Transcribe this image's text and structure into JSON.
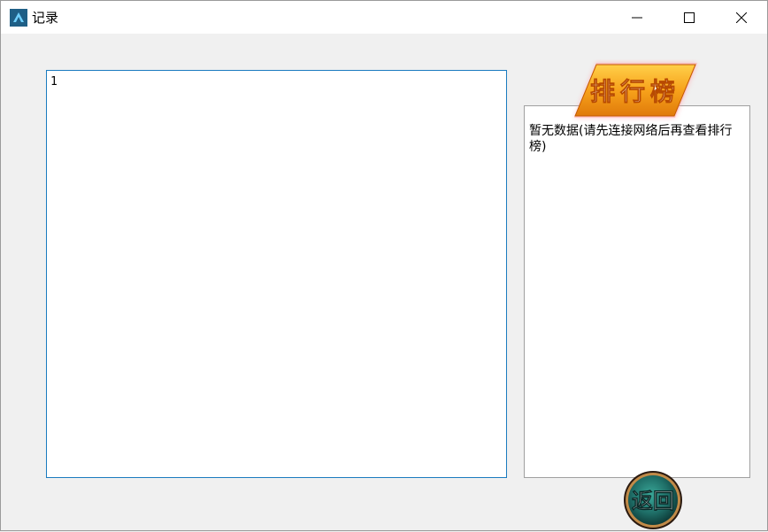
{
  "window": {
    "title": "记录",
    "app_icon": "app-logo-icon",
    "controls": [
      "minimize-icon",
      "maximize-icon",
      "close-icon"
    ]
  },
  "record_panel": {
    "content": "1"
  },
  "leaderboard": {
    "banner_label": "排行榜",
    "message": "暂无数据(请先连接网络后再查看排行榜)"
  },
  "back_button": {
    "label": "返回"
  },
  "colors": {
    "record_border": "#1a7bbf",
    "banner_orange": "#f7a21b",
    "back_button_teal": "#1f6f68"
  }
}
